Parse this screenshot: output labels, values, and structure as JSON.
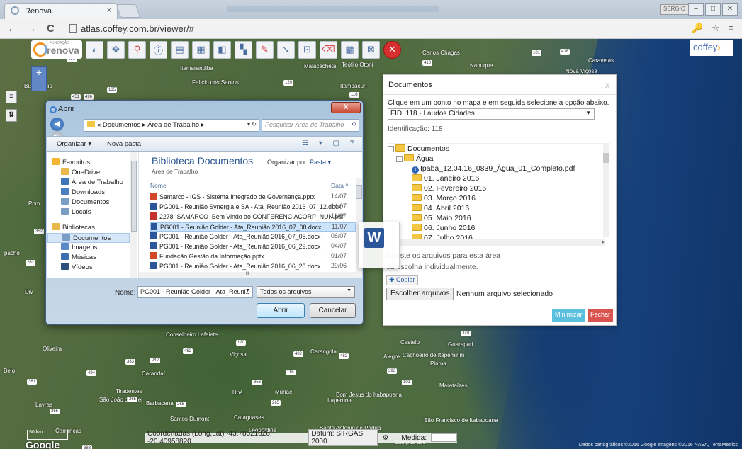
{
  "browser": {
    "tab_title": "Renova",
    "tab_close": "×",
    "url": "atlas.coffey.com.br/viewer/#",
    "user_badge": "SERGIO",
    "back": "←",
    "forward": "→",
    "reload": "C",
    "right_icons": "🔑 ☆ ≡",
    "win_min": "–",
    "win_max": "□",
    "win_close": "✕"
  },
  "map": {
    "logo_text": "renova",
    "logo_sub": "FUNDAÇÃO",
    "brand": "coffey",
    "zoom_in": "+",
    "zoom_out": "–",
    "side_btn_1": "≡",
    "side_btn_2": "⇅",
    "towns": [
      {
        "name": "Itamarandiba"
      },
      {
        "name": "Malacacheta"
      },
      {
        "name": "Teófilo Otoni"
      },
      {
        "name": "Carlos Chagas"
      },
      {
        "name": "Nanuque"
      },
      {
        "name": "Caravelas"
      },
      {
        "name": "Nova Viçosa"
      },
      {
        "name": "Buenópolis"
      },
      {
        "name": "Felício dos Santos"
      },
      {
        "name": "Itambacuri"
      },
      {
        "name": "Conselheiro Lafaiete"
      },
      {
        "name": "Viçosa"
      },
      {
        "name": "Carangola"
      },
      {
        "name": "Alegre"
      },
      {
        "name": "Cachoeiro de Itapemirim"
      },
      {
        "name": "Piúma"
      },
      {
        "name": "Guarapari"
      },
      {
        "name": "Castelo"
      },
      {
        "name": "Marataízes"
      },
      {
        "name": "Ubá"
      },
      {
        "name": "Muriaé"
      },
      {
        "name": "Itaperuna"
      },
      {
        "name": "Bom Jesus do Itabapoana"
      },
      {
        "name": "Barbacena"
      },
      {
        "name": "São João del Rei"
      },
      {
        "name": "Lavras"
      },
      {
        "name": "Oliveira"
      },
      {
        "name": "Tiradentes"
      },
      {
        "name": "Cataguases"
      },
      {
        "name": "Santos Dumont"
      },
      {
        "name": "Leopoldina"
      },
      {
        "name": "Santo Antônio de Pádua"
      },
      {
        "name": "São Francisco de Itabapoana"
      },
      {
        "name": "Campos dos"
      },
      {
        "name": "Carrancas"
      },
      {
        "name": "Belo"
      },
      {
        "name": "pacho"
      },
      {
        "name": "Div"
      },
      {
        "name": "Pom"
      },
      {
        "name": "Carandaí"
      }
    ],
    "status": {
      "coords": "Coordenadas (Long,Lat) -43.78621826, -20.40958820",
      "datum": "Datum: SIRGAS 2000",
      "medida": "Medida:"
    },
    "scale_top": "50 km",
    "scale_bottom": "20 mi",
    "google": "Google",
    "copyright": "Dados cartográficos ©2016 Google Imagens ©2016 NASA, TerraMetrics"
  },
  "docs_panel": {
    "title": "Documentos",
    "close": "x",
    "hint": "Clique em um ponto no mapa e em seguida selecione a opção abaixo.",
    "selected": "FID: 118 - Laudos Cidades",
    "identification": "Identificação: 118",
    "tree": [
      {
        "label": "Documentos",
        "type": "folder",
        "level": 0,
        "toggle": "⊟"
      },
      {
        "label": "Água",
        "type": "folder",
        "level": 1,
        "toggle": "⊟"
      },
      {
        "label": "Ipaba_12.04.16_0839_Água_01_Completo.pdf",
        "type": "file",
        "level": 2
      },
      {
        "label": "01. Janeiro 2016",
        "type": "folder",
        "level": 2
      },
      {
        "label": "02. Fevereiro 2016",
        "type": "folder",
        "level": 2
      },
      {
        "label": "03. Março 2016",
        "type": "folder",
        "level": 2
      },
      {
        "label": "04. Abril 2016",
        "type": "folder",
        "level": 2
      },
      {
        "label": "05. Maio 2016",
        "type": "folder",
        "level": 2
      },
      {
        "label": "06. Junho 2016",
        "type": "folder",
        "level": 2
      },
      {
        "label": "07. Julho 2016",
        "type": "folder",
        "level": 2
      }
    ],
    "drop_line1": "Arraste os arquivos para esta área",
    "drop_line2": "ou escolha individualmente.",
    "copy_button": "✚ Copiar",
    "choose_button": "Escolher arquivos",
    "no_file": "Nenhum arquivo selecionado",
    "minimize": "Minimizar",
    "close_button": "Fechar"
  },
  "open_dialog": {
    "title": "Abrir",
    "close": "X",
    "nav_back": "◀",
    "nav_fwd": "▶",
    "path": "« Documentos ▸ Área de Trabalho ▸",
    "refresh": "▾ ↻",
    "search_placeholder": "Pesquisar Área de Trabalho",
    "organize": "Organizar ▾",
    "new_folder": "Nova pasta",
    "views": "☷ ▾ ▢ ?",
    "nav_items": [
      {
        "label": "Favoritos",
        "icon": "star-icon",
        "color": "#f2b632"
      },
      {
        "label": "OneDrive",
        "icon": "folder-icon",
        "color": "#e8b84a"
      },
      {
        "label": "Área de Trabalho",
        "icon": "desktop-icon",
        "color": "#3e74b8"
      },
      {
        "label": "Downloads",
        "icon": "downloads-icon",
        "color": "#4a7fc2"
      },
      {
        "label": "Documentos",
        "icon": "documents-icon",
        "color": "#7b9dc4"
      },
      {
        "label": "Locais",
        "icon": "places-icon",
        "color": "#7b9dc4"
      },
      {
        "label": "Bibliotecas",
        "icon": "library-icon",
        "color": "#e8b84a"
      },
      {
        "label": "Documentos",
        "icon": "documents-icon",
        "color": "#7b9dc4"
      },
      {
        "label": "Imagens",
        "icon": "pictures-icon",
        "color": "#5a8bc8"
      },
      {
        "label": "Músicas",
        "icon": "music-icon",
        "color": "#3b6fb0"
      },
      {
        "label": "Vídeos",
        "icon": "videos-icon",
        "color": "#2d4f7c"
      }
    ],
    "library_title": "Biblioteca Documentos",
    "library_sub": "Área de Trabalho",
    "arrange_label": "Organizar por:",
    "arrange_value": "Pasta ▾",
    "col_name": "Nome",
    "col_date": "Data ^",
    "files": [
      {
        "name": "Samarco - IGS - Sistema Integrado de Governança.pptx",
        "date": "14/07",
        "color": "#d24726"
      },
      {
        "name": "PG001 - Reunião Synergia e SA - Ata_Reunião 2016_07_12.docx",
        "date": "14/07",
        "color": "#2b579a"
      },
      {
        "name": "2278_SAMARCO_Bem Vindo ao CONFERENCIACORP_NUN.pdf",
        "date": "11/07",
        "color": "#c4302b"
      },
      {
        "name": "PG001 - Reunião Golder - Ata_Reunião 2016_07_08.docx",
        "date": "11/07",
        "color": "#2b579a",
        "selected": true
      },
      {
        "name": "PG001 - Reunião Golder - Ata_Reunião 2016_07_05.docx",
        "date": "06/07",
        "color": "#2b579a"
      },
      {
        "name": "PG001 - Reunião Golder - Ata_Reunião 2016_06_29.docx",
        "date": "04/07",
        "color": "#2b579a"
      },
      {
        "name": "Fundação Gestão da Informação.pptx",
        "date": "01/07",
        "color": "#d24726"
      },
      {
        "name": "PG001 - Reunião Golder - Ata_Reunião 2016_06_28.docx",
        "date": "29/06",
        "color": "#2b579a"
      }
    ],
    "hscroll_grip": "III",
    "name_label": "Nome:",
    "name_value": "PG001 - Reunião Golder - Ata_Reuniã",
    "type_value": "Todos os arquivos",
    "open_button": "Abrir",
    "cancel_button": "Cancelar"
  },
  "drag_icon": "W"
}
